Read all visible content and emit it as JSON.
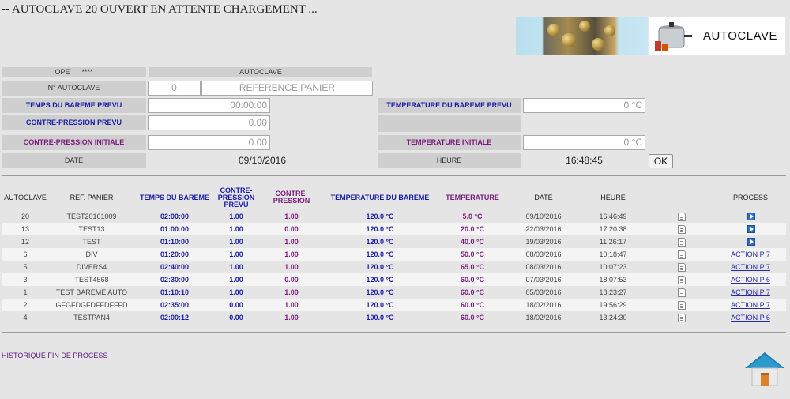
{
  "title": "-- AUTOCLAVE 20 OUVERT EN ATTENTE CHARGEMENT ...",
  "header": {
    "logo_text": "AUTOCLAVE"
  },
  "form": {
    "ope_label": "OPE",
    "ope_value": "****",
    "autoclave_label": "AUTOCLAVE",
    "num_autoclave_label": "N° AUTOCLAVE",
    "num_autoclave_value": "0",
    "reference_panier_placeholder": "REFERENCE PANIER",
    "temps_bareme_label": "TEMPS DU BAREME PREVU",
    "temps_bareme_value": "00:00:00",
    "temperature_bareme_label": "TEMPERATURE DU BAREME PREVU",
    "temperature_bareme_value": "0 °C",
    "contre_pression_prevu_label": "CONTRE-PRESSION PREVU",
    "contre_pression_prevu_value": "0.00",
    "contre_pression_initiale_label": "CONTRE-PRESSION INITIALE",
    "contre_pression_initiale_value": "0.00",
    "temperature_initiale_label": "TEMPERATURE INITIALE",
    "temperature_initiale_value": "0 °C",
    "date_label": "DATE",
    "date_value": "09/10/2016",
    "heure_label": "HEURE",
    "heure_value": "16:48:45",
    "ok_label": "OK"
  },
  "table": {
    "headers": {
      "autoclave": "AUTOCLAVE",
      "ref_panier": "REF. PANIER",
      "temps_bareme": "TEMPS DU BAREME",
      "contre_pression_prevu": "CONTRE-PRESSION PREVU",
      "contre_pression": "CONTRE-PRESSION",
      "temperature_bareme": "TEMPERATURE DU BAREME",
      "temperature": "TEMPERATURE",
      "date": "DATE",
      "heure": "HEURE",
      "process": "PROCESS"
    },
    "rows": [
      {
        "autoclave": "20",
        "ref": "TEST20161009",
        "temps": "02:00:00",
        "cp_prevu": "1.00",
        "cp": "1.00",
        "temp_bareme": "120.0 °C",
        "temp": "5.0 °C",
        "date": "09/10/2016",
        "heure": "16:46:49",
        "process": ""
      },
      {
        "autoclave": "13",
        "ref": "TEST13",
        "temps": "01:00:00",
        "cp_prevu": "1.00",
        "cp": "0.00",
        "temp_bareme": "120.0 °C",
        "temp": "20.0 °C",
        "date": "22/03/2016",
        "heure": "17:20:38",
        "process": ""
      },
      {
        "autoclave": "12",
        "ref": "TEST",
        "temps": "01:10:00",
        "cp_prevu": "1.00",
        "cp": "1.00",
        "temp_bareme": "120.0 °C",
        "temp": "40.0 °C",
        "date": "19/03/2016",
        "heure": "11:26:17",
        "process": ""
      },
      {
        "autoclave": "6",
        "ref": "DIV",
        "temps": "01:20:00",
        "cp_prevu": "1.00",
        "cp": "1.00",
        "temp_bareme": "120.0 °C",
        "temp": "50.0 °C",
        "date": "08/03/2016",
        "heure": "10:18:47",
        "process": "ACTION P 7"
      },
      {
        "autoclave": "5",
        "ref": "DIVERS4",
        "temps": "02:40:00",
        "cp_prevu": "1.00",
        "cp": "1.00",
        "temp_bareme": "120.0 °C",
        "temp": "65.0 °C",
        "date": "08/03/2016",
        "heure": "10:07:23",
        "process": "ACTION P 7"
      },
      {
        "autoclave": "3",
        "ref": "TEST4568",
        "temps": "02:30:00",
        "cp_prevu": "1.00",
        "cp": "0.00",
        "temp_bareme": "120.0 °C",
        "temp": "60.0 °C",
        "date": "07/03/2016",
        "heure": "18:07:53",
        "process": "ACTION P 6"
      },
      {
        "autoclave": "1",
        "ref": "TEST BAREME AUTO",
        "temps": "01:10:10",
        "cp_prevu": "1.00",
        "cp": "1.00",
        "temp_bareme": "120.0 °C",
        "temp": "60.0 °C",
        "date": "05/03/2016",
        "heure": "18:23:27",
        "process": "ACTION P 7"
      },
      {
        "autoclave": "2",
        "ref": "GFGFDGFDFFDFFFD",
        "temps": "02:35:00",
        "cp_prevu": "0.00",
        "cp": "1.00",
        "temp_bareme": "120.0 °C",
        "temp": "60.0 °C",
        "date": "18/02/2016",
        "heure": "19:56:29",
        "process": "ACTION P 7"
      },
      {
        "autoclave": "4",
        "ref": "TESTPAN4",
        "temps": "02:00:12",
        "cp_prevu": "0.00",
        "cp": "1.00",
        "temp_bareme": "100.0 °C",
        "temp": "60.0 °C",
        "date": "18/02/2016",
        "heure": "13:24:30",
        "process": "ACTION P 6"
      }
    ]
  },
  "footer": {
    "historique_link": "HISTORIQUE FIN DE PROCESS"
  },
  "icons": {
    "detail": "document-icon",
    "process": "play-icon",
    "home": "home-icon"
  },
  "colors": {
    "label_blue": "#1a1aa8",
    "label_purple": "#7b1a7b",
    "link": "#2a2aa8"
  }
}
